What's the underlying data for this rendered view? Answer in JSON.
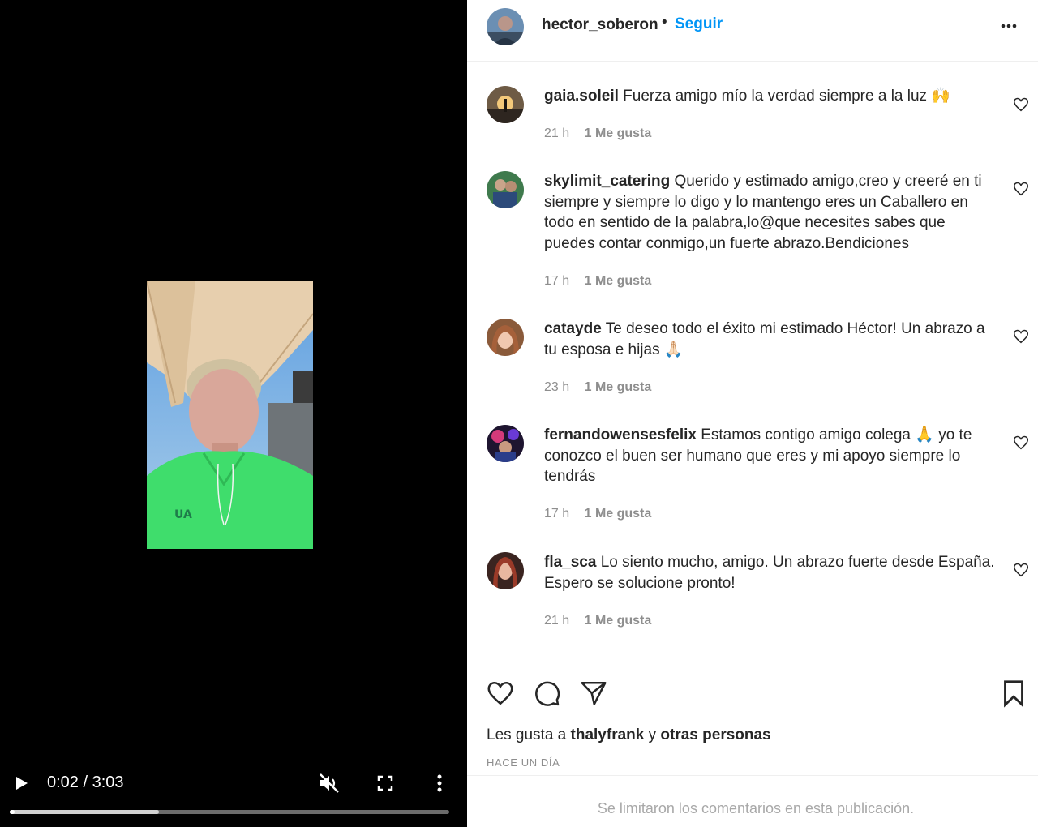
{
  "video": {
    "time_current": "0:02",
    "time_separator": "/",
    "time_total": "3:03",
    "progress_fraction": 0.0115,
    "buffered_fraction": 0.34
  },
  "post": {
    "author": "hector_soberon",
    "separator": "•",
    "follow_label": "Seguir",
    "likes_prefix": "Les gusta a",
    "likes_user": "thalyfrank",
    "likes_join": "y",
    "likes_others": "otras personas",
    "date": "HACE UN DÍA",
    "comments_limited": "Se limitaron los comentarios en esta publicación."
  },
  "comments": [
    {
      "user": "gaia.soleil",
      "text": "Fuerza amigo mío la verdad siempre a la luz 🙌",
      "time": "21 h",
      "likes": "1 Me gusta"
    },
    {
      "user": "skylimit_catering",
      "text": "Querido y estimado amigo,creo y creeré en ti siempre y siempre lo digo y lo mantengo eres un Caballero en todo en sentido de la palabra,lo@que necesites sabes que puedes contar conmigo,un fuerte abrazo.Bendiciones",
      "time": "17 h",
      "likes": "1 Me gusta"
    },
    {
      "user": "catayde",
      "text": "Te deseo todo el éxito mi estimado Héctor! Un abrazo a tu esposa e hijas 🙏🏻",
      "time": "23 h",
      "likes": "1 Me gusta"
    },
    {
      "user": "fernandowensesfelix",
      "text": "Estamos contigo amigo colega 🙏 yo te conozco el buen ser humano que eres y mi apoyo siempre lo tendrás",
      "time": "17 h",
      "likes": "1 Me gusta"
    },
    {
      "user": "fla_sca",
      "text": "Lo siento mucho, amigo. Un abrazo fuerte desde España. Espero se solucione pronto!",
      "time": "21 h",
      "likes": "1 Me gusta"
    }
  ],
  "icons": {
    "play": "play-icon",
    "mute": "volume-muted-icon",
    "fullscreen": "fullscreen-icon",
    "video_more": "more-vertical-icon",
    "post_options": "more-horizontal-icon",
    "comment_like": "heart-outline-icon",
    "like": "heart-icon",
    "comment": "comment-bubble-icon",
    "share": "paper-plane-icon",
    "save": "bookmark-icon"
  },
  "colors": {
    "accent": "#0095f6",
    "text": "#262626",
    "muted": "#8e8e8e",
    "video_bg": "#000000"
  }
}
